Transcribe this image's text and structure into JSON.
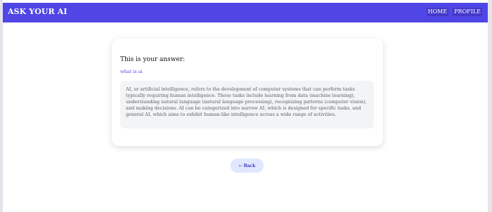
{
  "navbar": {
    "brand": "ASK YOUR AI",
    "links": [
      {
        "label": "HOME"
      },
      {
        "label": "PROFILE"
      }
    ]
  },
  "card": {
    "title": "This is your answer:",
    "question": "what is ai",
    "answer": "AI, or artificial intelligence, refers to the development of computer systems that can perform tasks typically requiring human intelligence. These tasks include learning from data (machine learning), understanding natural language (natural language processing), recognizing patterns (computer vision), and making decisions. AI can be categorized into narrow AI, which is designed for specific tasks, and general AI, which aims to exhibit human-like intelligence across a wide range of activities."
  },
  "back_button": {
    "icon": "arrow-left-icon",
    "label": "Back"
  },
  "colors": {
    "accent": "#4f46e5",
    "button_bg": "#e0e7ff",
    "answer_bg": "#f3f4f6"
  }
}
